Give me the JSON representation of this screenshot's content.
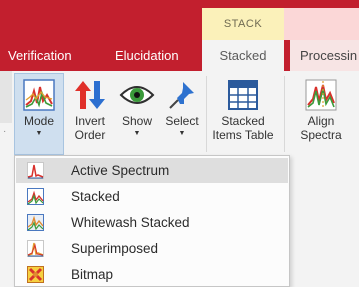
{
  "context_tab": {
    "label": "STACK"
  },
  "tabs": [
    {
      "label": "Verification"
    },
    {
      "label": "Elucidation"
    },
    {
      "label": "Stacked",
      "selected": true
    },
    {
      "label": "Processin"
    }
  ],
  "ribbon": {
    "mode": {
      "label": "Mode",
      "icon": "mode-spectrum-icon"
    },
    "invert": {
      "line1": "Invert",
      "line2": "Order",
      "icon": "invert-arrows-icon"
    },
    "show": {
      "label": "Show",
      "icon": "eye-icon"
    },
    "select": {
      "label": "Select",
      "icon": "pin-icon"
    },
    "stacked_table": {
      "line1": "Stacked",
      "line2": "Items Table",
      "icon": "table-icon"
    },
    "align": {
      "line1": "Align",
      "line2": "Spectra",
      "icon": "align-spectra-icon"
    }
  },
  "mode_menu": {
    "items": [
      {
        "label": "Active Spectrum",
        "icon": "active-spectrum-icon",
        "highlighted": true
      },
      {
        "label": "Stacked",
        "icon": "stacked-icon"
      },
      {
        "label": "Whitewash Stacked",
        "icon": "whitewash-stacked-icon"
      },
      {
        "label": "Superimposed",
        "icon": "superimposed-icon"
      },
      {
        "label": "Bitmap",
        "icon": "bitmap-icon"
      }
    ]
  },
  "colors": {
    "title_red": "#c21f2e",
    "context_yellow": "#fbf1ba",
    "mode_highlight": "#cfdfef",
    "menu_hover": "#dedede"
  }
}
